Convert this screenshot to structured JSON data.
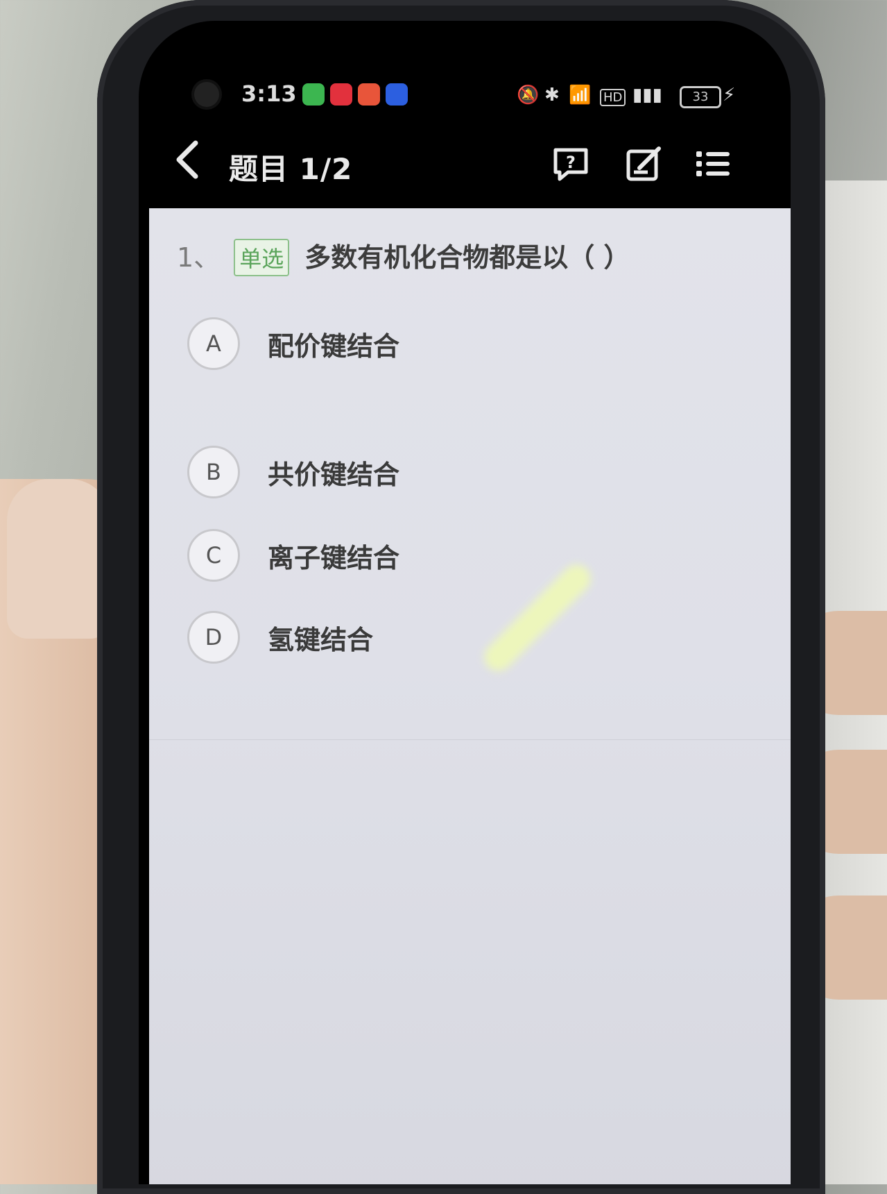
{
  "status_bar": {
    "time": "3:13",
    "battery": "33",
    "icons": [
      "wechat-icon",
      "message-icon",
      "app-icon",
      "alipay-icon",
      "mute-icon",
      "bluetooth-icon",
      "wifi-icon",
      "hd-icon",
      "signal-5g-icon",
      "charging-icon"
    ]
  },
  "nav": {
    "title": "题目 1/2",
    "icons": [
      "back-icon",
      "help-icon",
      "edit-icon",
      "menu-icon"
    ]
  },
  "question": {
    "number": "1、",
    "type_badge": "单选",
    "text": "多数有机化合物都是以（    ）"
  },
  "options": [
    {
      "letter": "A",
      "text": "配价键结合"
    },
    {
      "letter": "B",
      "text": "共价键结合"
    },
    {
      "letter": "C",
      "text": "离子键结合"
    },
    {
      "letter": "D",
      "text": "氢键结合"
    }
  ],
  "colors": {
    "badge_green": "#5aa45a",
    "content_bg": "#e2e3ea",
    "nav_bg": "#000000"
  }
}
